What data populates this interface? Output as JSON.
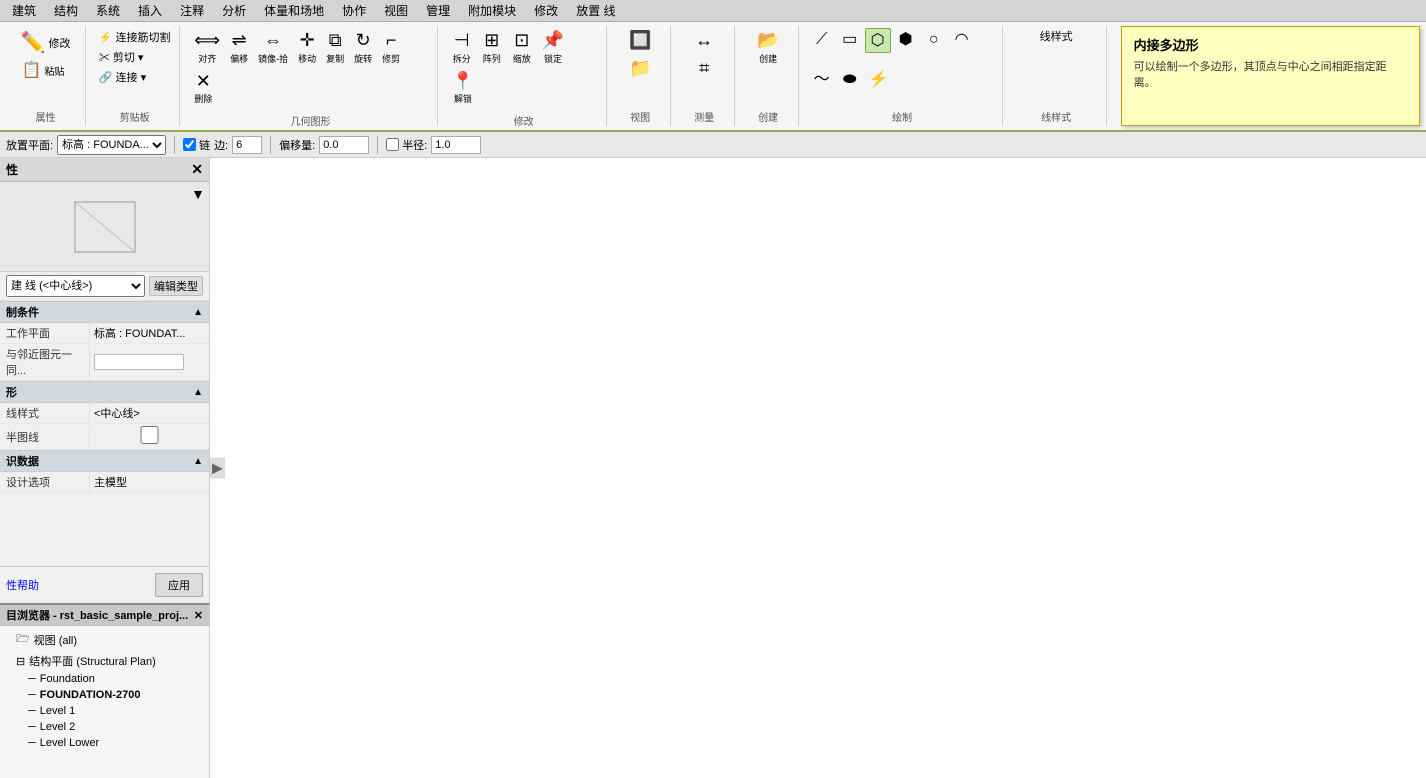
{
  "menuBar": {
    "items": [
      "建筑",
      "结构",
      "系统",
      "插入",
      "注释",
      "分析",
      "体量和场地",
      "协作",
      "视图",
      "管理",
      "附加模块",
      "修改",
      "放置 线"
    ]
  },
  "ribbonTabs": {
    "active": "修改 | 放置 线",
    "tabs": [
      "修改 | 放置 线"
    ]
  },
  "ribbon": {
    "groups": [
      {
        "label": "属性",
        "items": []
      },
      {
        "label": "剪贴板",
        "items": []
      },
      {
        "label": "几何图形",
        "items": []
      },
      {
        "label": "修改",
        "items": []
      },
      {
        "label": "视图",
        "items": []
      },
      {
        "label": "测量",
        "items": []
      },
      {
        "label": "创建",
        "items": []
      },
      {
        "label": "绘制",
        "items": []
      },
      {
        "label": "线样式",
        "items": []
      }
    ]
  },
  "optionsBar": {
    "labelPlacer": "放置平面:",
    "heightLabel": "标高 : FOUNDA...",
    "checkbox_chain": "链",
    "side_label": "边:",
    "side_value": "6",
    "offset_label": "偏移量:",
    "offset_value": "0.0",
    "halfRadius_label": "半径:",
    "halfRadius_value": "1.0"
  },
  "leftPanel": {
    "title": "性",
    "type_selector": "建 线 (<中心线>)",
    "edit_type_btn": "编辑类型",
    "sections": [
      {
        "name": "制条件",
        "properties": [
          {
            "label": "工作平面",
            "value": "标高 : FOUNDAT..."
          },
          {
            "label": "与邻近图元一同...",
            "value": ""
          }
        ]
      },
      {
        "name": "形",
        "properties": [
          {
            "label": "线样式",
            "value": "<中心线>"
          },
          {
            "label": "半图线",
            "value": ""
          }
        ]
      },
      {
        "name": "识数据",
        "properties": [
          {
            "label": "设计选项",
            "value": "主模型"
          }
        ]
      }
    ],
    "help_link": "性帮助",
    "apply_btn": "应用"
  },
  "browserPanel": {
    "title": "目浏览器 - rst_basic_sample_proj...",
    "tree": [
      {
        "level": 0,
        "text": "视图 (all)",
        "icon": "folder",
        "expanded": true
      },
      {
        "level": 1,
        "text": "结构平面 (Structural Plan)",
        "icon": "folder",
        "expanded": true
      },
      {
        "level": 2,
        "text": "Foundation",
        "icon": "view",
        "selected": false
      },
      {
        "level": 2,
        "text": "FOUNDATION-2700",
        "icon": "view",
        "selected": true,
        "bold": true
      },
      {
        "level": 2,
        "text": "Level 1",
        "icon": "view",
        "selected": false
      },
      {
        "level": 2,
        "text": "Level 2",
        "icon": "view",
        "selected": false
      },
      {
        "level": 2,
        "text": "Level Lower",
        "icon": "view",
        "selected": false
      }
    ]
  },
  "tooltip": {
    "title": "内接多边形",
    "description": "可以绘制一个多边形，其顶点与中心之间相距指定距离。"
  }
}
